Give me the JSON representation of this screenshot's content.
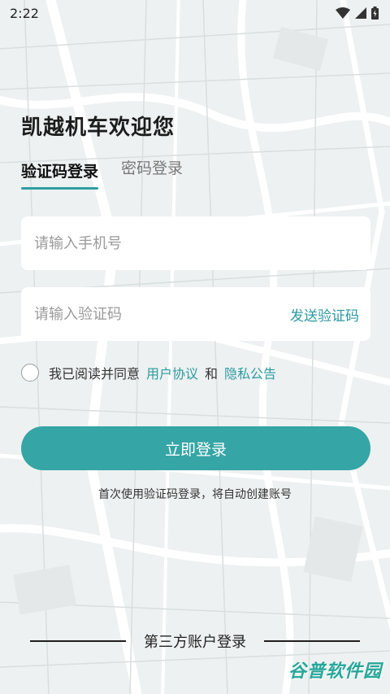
{
  "status_bar": {
    "time": "2:22"
  },
  "welcome_title": "凯越机车欢迎您",
  "tabs": [
    {
      "label": "验证码登录",
      "active": true
    },
    {
      "label": "密码登录",
      "active": false
    }
  ],
  "phone_field": {
    "placeholder": "请输入手机号",
    "value": ""
  },
  "code_field": {
    "placeholder": "请输入验证码",
    "value": "",
    "send_label": "发送验证码"
  },
  "agreement": {
    "checked": false,
    "prefix": "我已阅读并同意",
    "user_agreement": "用户协议",
    "and": "和",
    "privacy_notice": "隐私公告"
  },
  "login_button": "立即登录",
  "login_hint": "首次使用验证码登录，将自动创建账号",
  "third_party_label": "第三方账户登录",
  "watermark": "谷普软件园",
  "colors": {
    "accent": "#35a5a6",
    "link": "#2c9aa0"
  }
}
